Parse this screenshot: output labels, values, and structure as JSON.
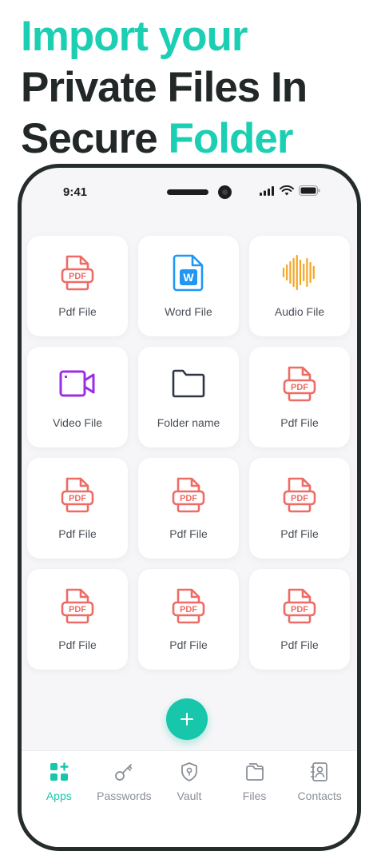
{
  "headline": {
    "line1": "Import your",
    "line2": "Private Files In",
    "line3_part1": "Secure ",
    "line3_part2": "Folder"
  },
  "status": {
    "time": "9:41"
  },
  "files": [
    {
      "label": "Pdf File",
      "icon": "pdf-icon"
    },
    {
      "label": "Word File",
      "icon": "word-icon"
    },
    {
      "label": "Audio File",
      "icon": "audio-icon"
    },
    {
      "label": "Video File",
      "icon": "video-icon"
    },
    {
      "label": "Folder name",
      "icon": "folder-icon"
    },
    {
      "label": "Pdf File",
      "icon": "pdf-icon"
    },
    {
      "label": "Pdf File",
      "icon": "pdf-icon"
    },
    {
      "label": "Pdf File",
      "icon": "pdf-icon"
    },
    {
      "label": "Pdf File",
      "icon": "pdf-icon"
    },
    {
      "label": "Pdf File",
      "icon": "pdf-icon"
    },
    {
      "label": "Pdf File",
      "icon": "pdf-icon"
    },
    {
      "label": "Pdf File",
      "icon": "pdf-icon"
    }
  ],
  "icon_text": {
    "pdf": "PDF",
    "word": "W"
  },
  "tabs": [
    {
      "label": "Apps",
      "icon": "apps-icon"
    },
    {
      "label": "Passwords",
      "icon": "key-icon"
    },
    {
      "label": "Vault",
      "icon": "shield-icon"
    },
    {
      "label": "Files",
      "icon": "files-icon"
    },
    {
      "label": "Contacts",
      "icon": "contacts-icon"
    }
  ],
  "colors": {
    "accent": "#18c6ac",
    "pdf": "#ef6b65",
    "word": "#2196f3",
    "audio": "#f5a623",
    "video": "#9b2ee3",
    "folder": "#2f3545"
  }
}
